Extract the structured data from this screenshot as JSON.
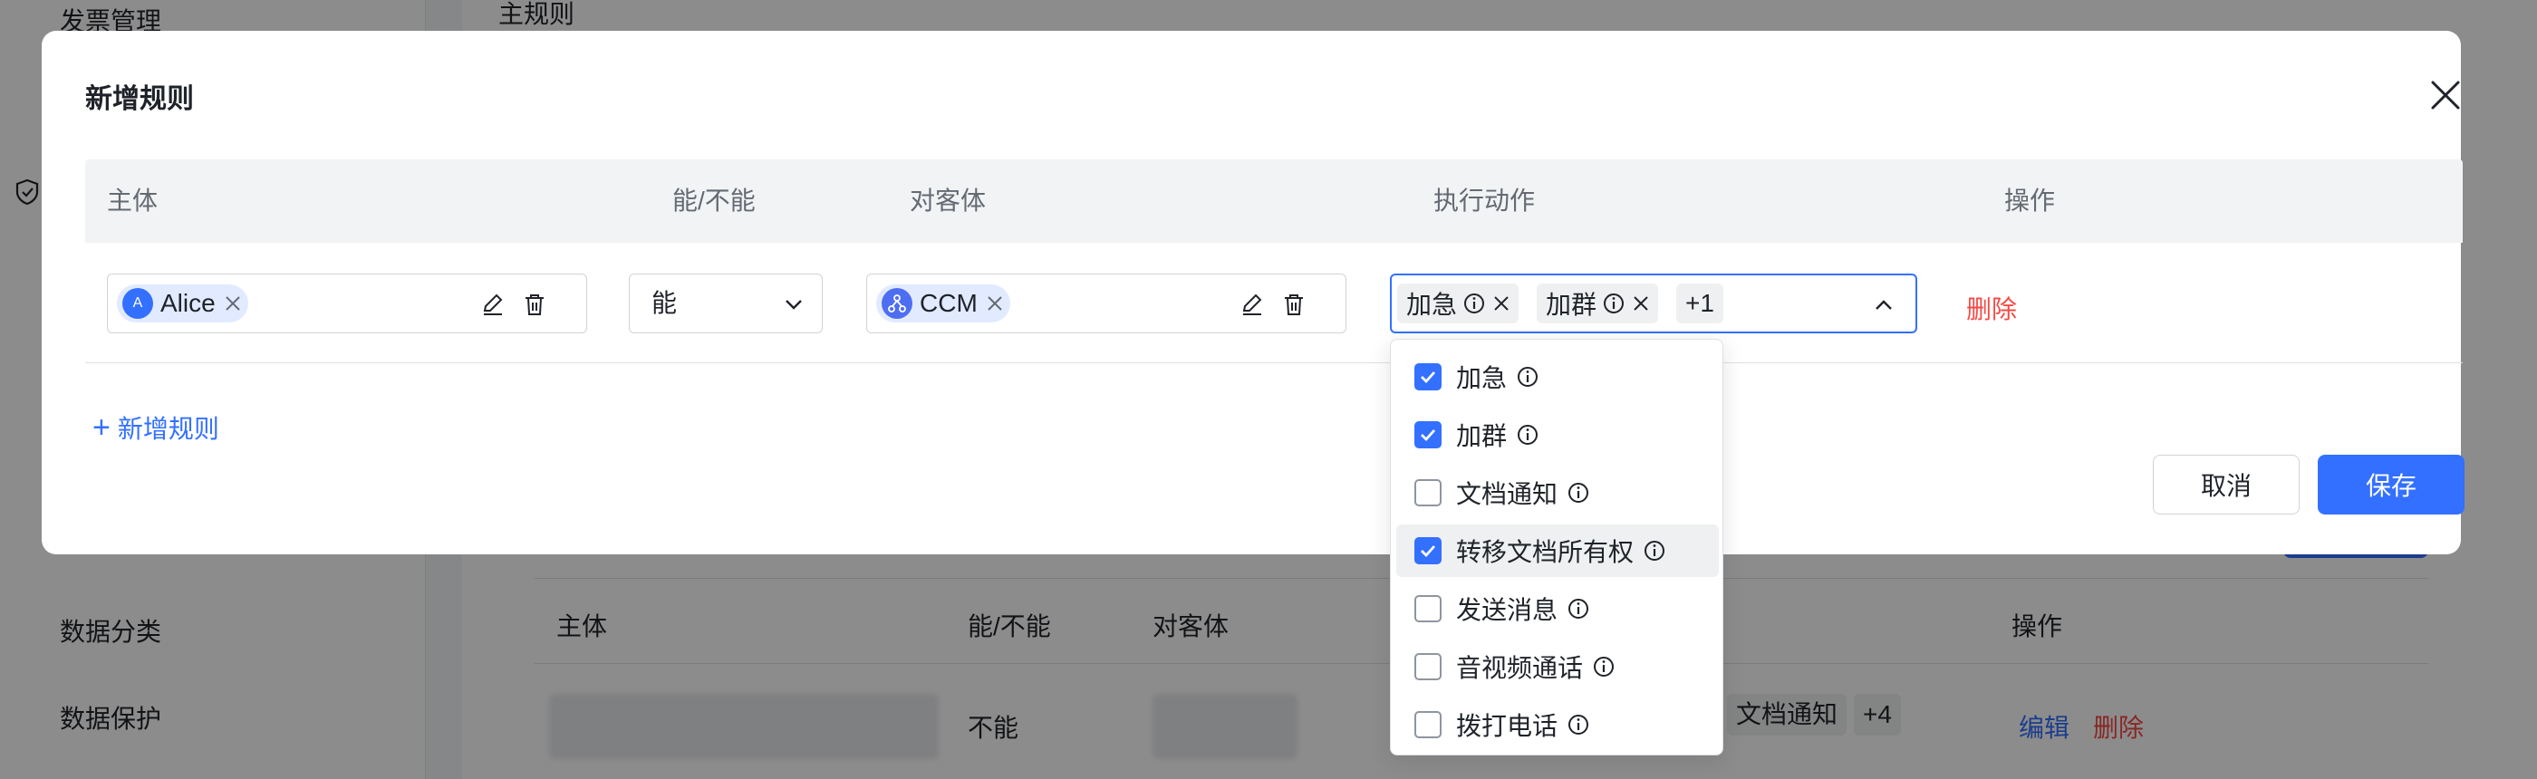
{
  "background": {
    "sidebar_items": [
      "发票管理",
      "数据分类",
      "数据保护"
    ],
    "content_title": "主规则",
    "table_headers": [
      "主体",
      "能/不能",
      "对客体",
      "操作"
    ],
    "row": {
      "can": "不能",
      "action_tags": [
        "文档通知",
        "+4"
      ],
      "edit": "编辑",
      "delete": "删除"
    }
  },
  "modal": {
    "title": "新增规则",
    "columns": [
      "主体",
      "能/不能",
      "对客体",
      "执行动作",
      "操作"
    ],
    "rule": {
      "subject": {
        "name": "Alice",
        "avatar_letter": "A"
      },
      "can_select": "能",
      "object": {
        "name": "CCM"
      },
      "actions": [
        "加急",
        "加群"
      ],
      "actions_more": "+1",
      "delete": "删除"
    },
    "add_rule": "新增规则",
    "cancel": "取消",
    "save": "保存"
  },
  "dropdown": {
    "options": [
      {
        "label": "加急",
        "checked": true
      },
      {
        "label": "加群",
        "checked": true
      },
      {
        "label": "文档通知",
        "checked": false
      },
      {
        "label": "转移文档所有权",
        "checked": true
      },
      {
        "label": "发送消息",
        "checked": false
      },
      {
        "label": "音视频通话",
        "checked": false
      },
      {
        "label": "拨打电话",
        "checked": false
      }
    ]
  },
  "colors": {
    "primary": "#3370ff",
    "danger": "#f54a45",
    "chip_bg": "#e1eaff",
    "tag_bg": "#eff0f1"
  }
}
